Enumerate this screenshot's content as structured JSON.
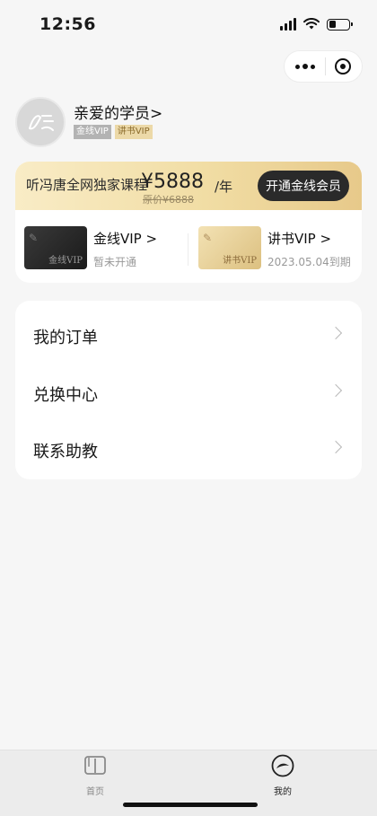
{
  "status": {
    "time": "12:56"
  },
  "profile": {
    "username": "亲爱的学员>",
    "badges": [
      "金线VIP",
      "讲书VIP"
    ]
  },
  "promo": {
    "text": "听冯唐全网独家课程",
    "price": "¥5888",
    "per": "/年",
    "original": "原价¥6888",
    "button": "开通金线会员"
  },
  "vip": [
    {
      "title": "金线VIP >",
      "subtitle": "暂未开通",
      "caption": "金线VIP"
    },
    {
      "title": "讲书VIP >",
      "subtitle": "2023.05.04到期",
      "caption": "讲书VIP"
    }
  ],
  "menu": [
    {
      "label": "我的订单"
    },
    {
      "label": "兑换中心"
    },
    {
      "label": "联系助教"
    }
  ],
  "tabs": [
    {
      "label": "首页",
      "icon": "book-icon"
    },
    {
      "label": "我的",
      "icon": "profile-logo-icon"
    }
  ],
  "colors": {
    "accent_gold": "#e7c98a",
    "dark_button": "#2a2a2a"
  }
}
